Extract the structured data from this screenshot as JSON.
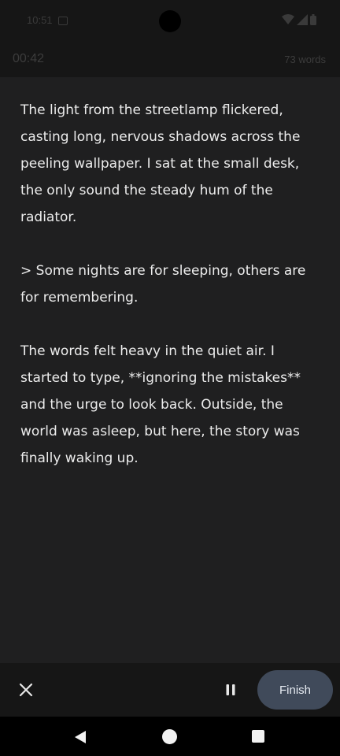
{
  "status_bar": {
    "time": "10:51",
    "icons": [
      "calendar-icon",
      "wifi-icon",
      "signal-icon",
      "battery-icon"
    ]
  },
  "session": {
    "timer": "00:42",
    "word_count": "73 words"
  },
  "editor": {
    "paragraphs": [
      "The light from the streetlamp flickered, casting long, nervous shadows across the peeling wallpaper. I sat at the small desk, the only sound the steady hum of the radiator.",
      "> Some nights are for sleeping, others are for remembering.",
      "The words felt heavy in the quiet air. I started to type, **ignoring the mistakes** and the urge to look back. Outside, the world was asleep, but here, the story was finally waking up."
    ]
  },
  "toolbar": {
    "close_icon": "close-icon",
    "pause_icon": "pause-icon",
    "finish_label": "Finish"
  },
  "navigation": {
    "icons": [
      "back-icon",
      "home-icon",
      "recents-icon"
    ]
  },
  "colors": {
    "background": "#1f1f20",
    "bars": "#161616",
    "text": "#ececec",
    "finish_button": "#404a5a"
  }
}
